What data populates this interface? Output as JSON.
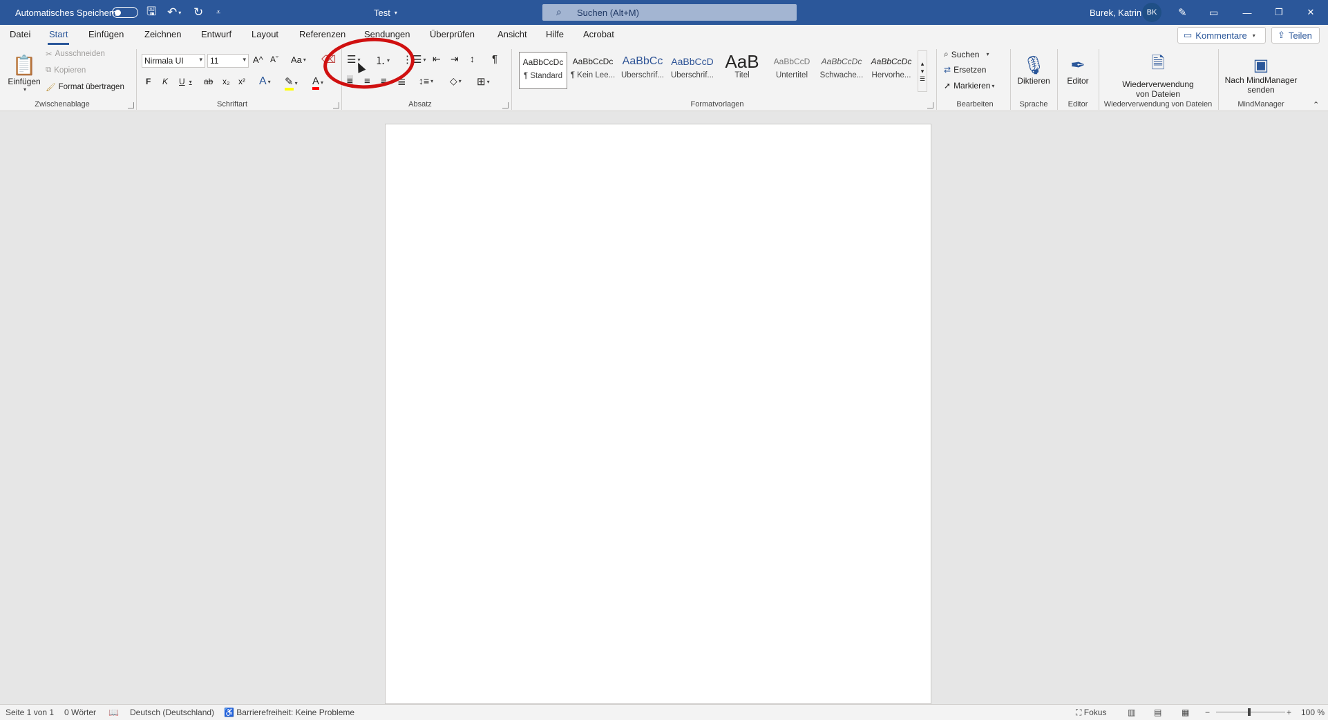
{
  "titlebar": {
    "autosave_label": "Automatisches Speichern",
    "doc_title": "Test",
    "search_placeholder": "Suchen (Alt+M)",
    "user_name": "Burek, Katrin",
    "user_initials": "BK"
  },
  "menu": {
    "tabs": [
      "Datei",
      "Start",
      "Einfügen",
      "Zeichnen",
      "Entwurf",
      "Layout",
      "Referenzen",
      "Sendungen",
      "Überprüfen",
      "Ansicht",
      "Hilfe",
      "Acrobat"
    ],
    "active_tab": "Start",
    "comments_label": "Kommentare",
    "share_label": "Teilen"
  },
  "ribbon": {
    "clipboard": {
      "paste": "Einfügen",
      "cut": "Ausschneiden",
      "copy": "Kopieren",
      "format_painter": "Format übertragen",
      "group": "Zwischenablage"
    },
    "font": {
      "font_name": "Nirmala UI",
      "font_size": "11",
      "bold": "F",
      "italic": "K",
      "underline": "U",
      "strike": "ab",
      "subscript": "x₂",
      "superscript": "x²",
      "change_case": "Aa",
      "grow": "A^",
      "shrink": "Aˇ",
      "group": "Schriftart"
    },
    "paragraph": {
      "group": "Absatz"
    },
    "styles": {
      "items": [
        {
          "preview": "AaBbCcDc",
          "name": "¶ Standard"
        },
        {
          "preview": "AaBbCcDc",
          "name": "¶ Kein Lee..."
        },
        {
          "preview": "AaBbCc",
          "name": "Überschrif..."
        },
        {
          "preview": "AaBbCcD",
          "name": "Überschrif..."
        },
        {
          "preview": "AaB",
          "name": "Titel"
        },
        {
          "preview": "AaBbCcD",
          "name": "Untertitel"
        },
        {
          "preview": "AaBbCcDc",
          "name": "Schwache..."
        },
        {
          "preview": "AaBbCcDc",
          "name": "Hervorhe..."
        }
      ],
      "group": "Formatvorlagen"
    },
    "editing": {
      "search": "Suchen",
      "replace": "Ersetzen",
      "select": "Markieren",
      "group": "Bearbeiten"
    },
    "voice": {
      "dictate": "Diktieren",
      "group": "Sprache"
    },
    "editor": {
      "label": "Editor",
      "group": "Editor"
    },
    "reuse": {
      "label_line1": "Wiederverwendung",
      "label_line2": "von Dateien",
      "group": "Wiederverwendung von Dateien"
    },
    "mindmanager": {
      "label_line1": "Nach MindManager",
      "label_line2": "senden",
      "group": "MindManager"
    }
  },
  "statusbar": {
    "page": "Seite 1 von 1",
    "words": "0 Wörter",
    "language": "Deutsch (Deutschland)",
    "accessibility": "Barrierefreiheit: Keine Probleme",
    "focus": "Fokus",
    "zoom": "100 %"
  },
  "colors": {
    "titlebar": "#2b579a",
    "annotation": "#d01010",
    "highlight": "#ffff00",
    "font_color": "#ff0000"
  }
}
